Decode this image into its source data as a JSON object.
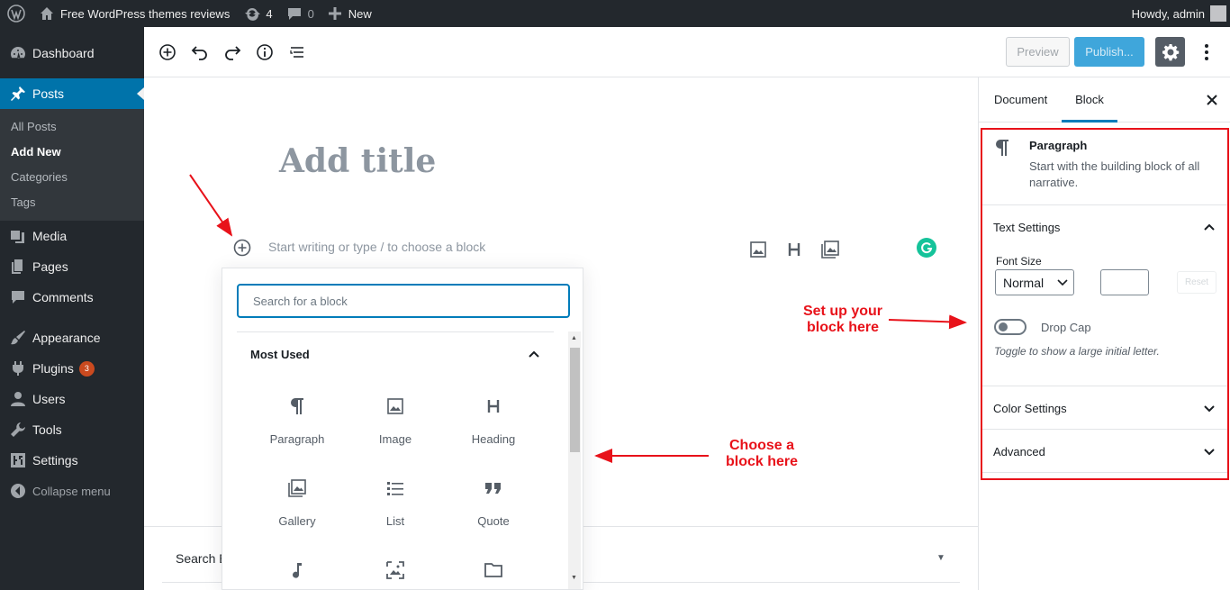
{
  "adminbar": {
    "site_name": "Free WordPress themes reviews",
    "updates_count": "4",
    "comments_count": "0",
    "new_label": "New",
    "greeting": "Howdy, admin"
  },
  "menu": {
    "dashboard": "Dashboard",
    "posts": "Posts",
    "posts_sub": [
      "All Posts",
      "Add New",
      "Categories",
      "Tags"
    ],
    "media": "Media",
    "pages": "Pages",
    "comments": "Comments",
    "appearance": "Appearance",
    "plugins": "Plugins",
    "plugins_badge": "3",
    "users": "Users",
    "tools": "Tools",
    "settings": "Settings",
    "collapse": "Collapse menu"
  },
  "toolbar": {
    "preview_label": "Preview",
    "publish_label": "Publish..."
  },
  "editor": {
    "title_placeholder": "Add title",
    "block_placeholder": "Start writing or type / to choose a block",
    "meta_box_label": "Search E"
  },
  "inserter": {
    "search_placeholder": "Search for a block",
    "panel_title": "Most Used",
    "blocks": [
      {
        "label": "Paragraph",
        "icon": "paragraph-icon"
      },
      {
        "label": "Image",
        "icon": "image-icon"
      },
      {
        "label": "Heading",
        "icon": "heading-icon"
      },
      {
        "label": "Gallery",
        "icon": "gallery-icon"
      },
      {
        "label": "List",
        "icon": "list-icon"
      },
      {
        "label": "Quote",
        "icon": "quote-icon"
      },
      {
        "label": "",
        "icon": "audio-icon"
      },
      {
        "label": "",
        "icon": "cover-icon"
      },
      {
        "label": "",
        "icon": "file-icon"
      }
    ]
  },
  "sidebar": {
    "tabs": [
      "Document",
      "Block"
    ],
    "active_tab": "Block",
    "block_name": "Paragraph",
    "block_description": "Start with the building block of all narrative.",
    "text_settings_title": "Text Settings",
    "font_size_label": "Font Size",
    "font_size_value": "Normal",
    "reset_label": "Reset",
    "drop_cap_label": "Drop Cap",
    "drop_cap_help": "Toggle to show a large initial letter.",
    "color_settings_title": "Color Settings",
    "advanced_title": "Advanced"
  },
  "annotations": {
    "callout_sidebar_line1": "Set up your",
    "callout_sidebar_line2": "block here",
    "callout_inserter_line1": "Choose a",
    "callout_inserter_line2": "block here",
    "color": "#e8121a"
  },
  "colors": {
    "admin_dark": "#23282d",
    "accent": "#0073aa",
    "primary": "#007cba"
  }
}
